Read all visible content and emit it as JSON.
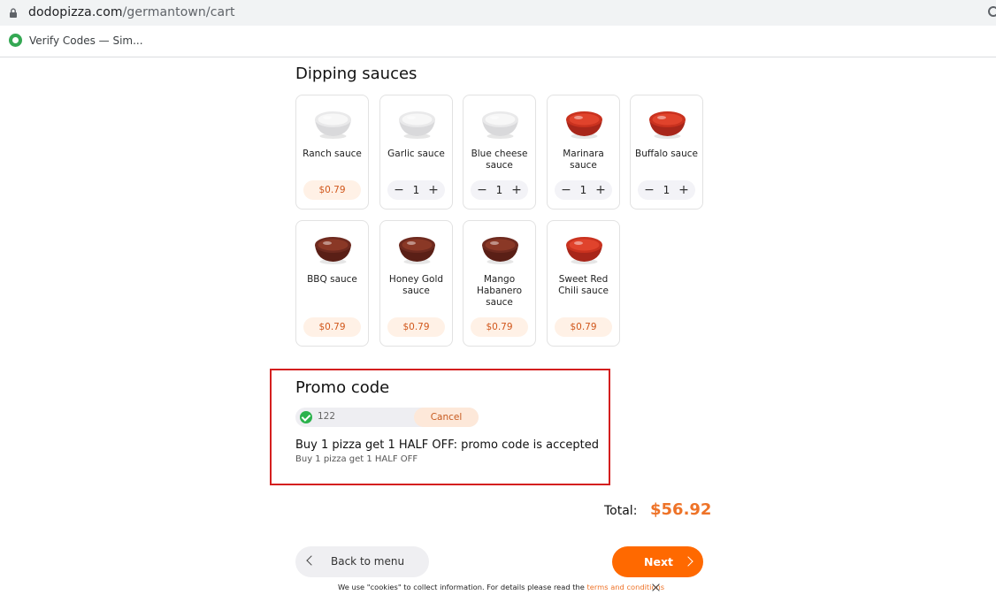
{
  "browser": {
    "url_host": "dodopizza.com",
    "url_path": "/germantown/cart",
    "bookmark_label": "Verify Codes — Sim..."
  },
  "sauces": {
    "title": "Dipping sauces",
    "items": [
      {
        "name": "Ranch sauce",
        "type": "price",
        "price": "$0.79",
        "color": "white"
      },
      {
        "name": "Garlic sauce",
        "type": "stepper",
        "qty": "1",
        "color": "white"
      },
      {
        "name": "Blue cheese sauce",
        "type": "stepper",
        "qty": "1",
        "color": "white"
      },
      {
        "name": "Marinara sauce",
        "type": "stepper",
        "qty": "1",
        "color": "red"
      },
      {
        "name": "Buffalo sauce",
        "type": "stepper",
        "qty": "1",
        "color": "red"
      },
      {
        "name": "BBQ sauce",
        "type": "price",
        "price": "$0.79",
        "color": "brown"
      },
      {
        "name": "Honey Gold sauce",
        "type": "price",
        "price": "$0.79",
        "color": "brown"
      },
      {
        "name": "Mango Habanero sauce",
        "type": "price",
        "price": "$0.79",
        "color": "brown"
      },
      {
        "name": "Sweet Red Chili sauce",
        "type": "price",
        "price": "$0.79",
        "color": "red"
      }
    ]
  },
  "promo": {
    "title": "Promo code",
    "code": "122",
    "cancel_label": "Cancel",
    "message": "Buy 1 pizza get 1 HALF OFF: promo code is accepted",
    "sub": "Buy 1 pizza get 1 HALF OFF"
  },
  "total": {
    "label": "Total:",
    "value": "$56.92"
  },
  "actions": {
    "back_label": "Back to menu",
    "next_label": "Next"
  },
  "cookie": {
    "text": "We use \"cookies\" to collect information. For details please read the",
    "link": "terms and conditions"
  },
  "colors": {
    "accent": "#ff6900",
    "price_text": "#d1571b",
    "promo_border": "#d41f1f",
    "success": "#2bb24c"
  }
}
